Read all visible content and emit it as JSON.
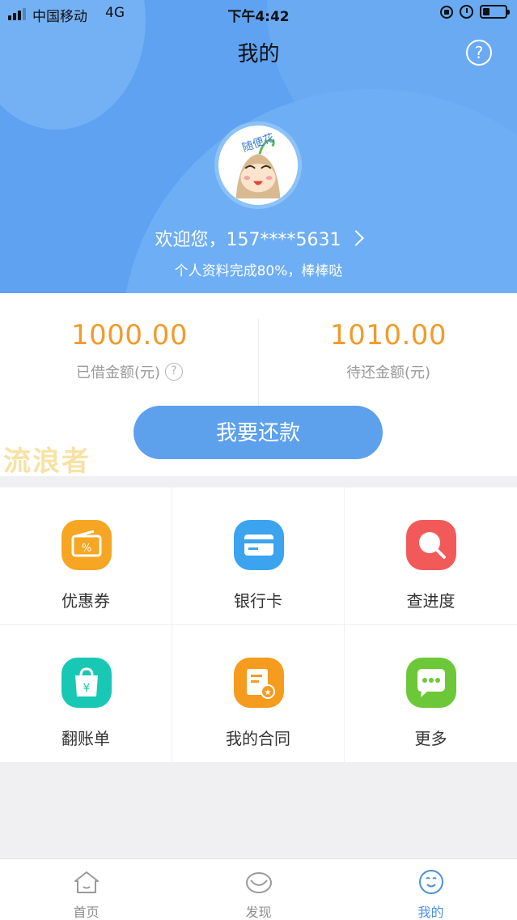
{
  "status_bar": {
    "carrier": "中国移动",
    "network": "4G",
    "time": "下午4:42"
  },
  "header": {
    "title": "我的",
    "help_symbol": "?",
    "welcome_text": "欢迎您，157****5631",
    "profile_progress": "个人资料完成80%，棒棒哒",
    "avatar_text": "随便花",
    "background_color": "#5fa2f1"
  },
  "amounts": {
    "borrowed": {
      "value": "1000.00",
      "label": "已借金额(元)",
      "help_symbol": "?"
    },
    "pending": {
      "value": "1010.00",
      "label": "待还金额(元)"
    },
    "value_color": "#f39a2a"
  },
  "repay_button": {
    "label": "我要还款",
    "color": "#5da0ec"
  },
  "watermark": "流浪者",
  "grid": {
    "items": [
      {
        "label": "优惠券",
        "icon": "coupon-icon",
        "color": "#f6a623"
      },
      {
        "label": "银行卡",
        "icon": "bank-card-icon",
        "color": "#3ca3ef"
      },
      {
        "label": "查进度",
        "icon": "search-progress-icon",
        "color": "#f25a5a"
      },
      {
        "label": "翻账单",
        "icon": "bill-bag-icon",
        "color": "#19c7b5"
      },
      {
        "label": "我的合同",
        "icon": "contract-icon",
        "color": "#f59b1e"
      },
      {
        "label": "更多",
        "icon": "more-chat-icon",
        "color": "#6cc838"
      }
    ]
  },
  "tabbar": {
    "tabs": [
      {
        "label": "首页",
        "icon": "home-icon",
        "active": false
      },
      {
        "label": "发现",
        "icon": "discover-icon",
        "active": false
      },
      {
        "label": "我的",
        "icon": "profile-face-icon",
        "active": true
      }
    ],
    "active_color": "#4a8fe0"
  }
}
